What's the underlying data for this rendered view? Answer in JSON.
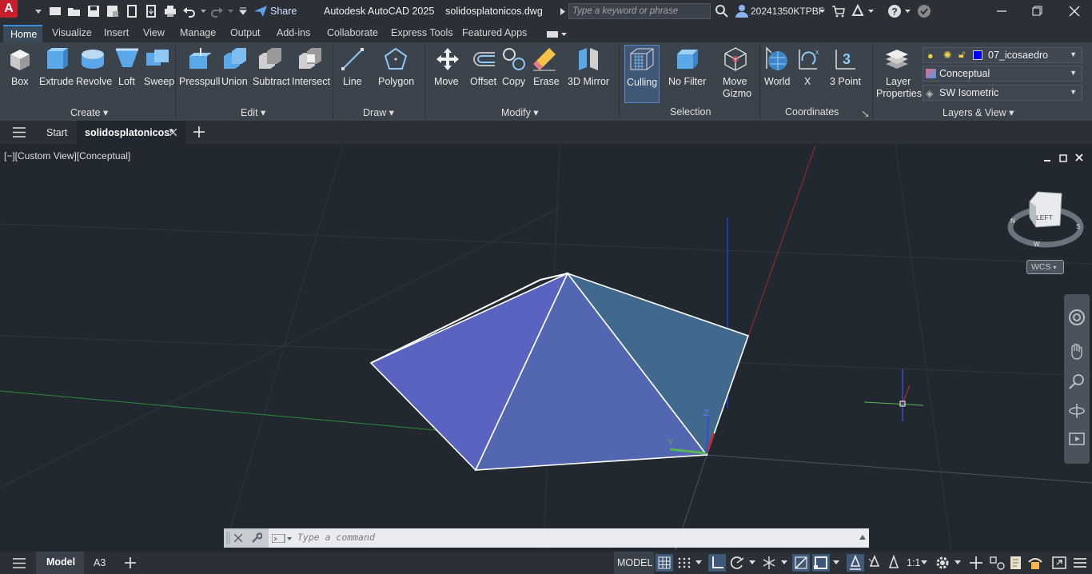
{
  "titlebar": {
    "logo_letter": "A",
    "share_label": "Share",
    "app_title": "Autodesk AutoCAD 2025    solidosplatonicos.dwg",
    "search_placeholder": "Type a keyword or phrase",
    "user_name": "20241350KTPBF"
  },
  "ribbon_tabs": [
    "Home",
    "Visualize",
    "Insert",
    "View",
    "Manage",
    "Output",
    "Add-ins",
    "Collaborate",
    "Express Tools",
    "Featured Apps"
  ],
  "ribbon": {
    "create": {
      "label": "Create",
      "tools": [
        "Box",
        "Extrude",
        "Revolve",
        "Loft",
        "Sweep"
      ]
    },
    "edit": {
      "label": "Edit",
      "tools": [
        "Presspull",
        "Union",
        "Subtract",
        "Intersect"
      ]
    },
    "draw": {
      "label": "Draw",
      "tools": [
        "Line",
        "Polygon"
      ]
    },
    "modify": {
      "label": "Modify",
      "tools": [
        "Move",
        "Offset",
        "Copy",
        "Erase",
        "3D Mirror"
      ]
    },
    "selection": {
      "label": "Selection",
      "tools": [
        "Culling",
        "No Filter",
        "Move",
        "Gizmo"
      ]
    },
    "coordinates": {
      "label": "Coordinates",
      "tools": [
        "World",
        "X",
        "3 Point"
      ]
    },
    "layers": {
      "label": "Layers & View",
      "layer_props_1": "Layer",
      "layer_props_2": "Properties",
      "current_layer": "07_icosaedro",
      "visual_style": "Conceptual",
      "view": "SW Isometric",
      "layer_color": "#0000ff"
    }
  },
  "file_tabs": {
    "start": "Start",
    "active": "solidosplatonicos*"
  },
  "viewport": {
    "label": "[−][Custom View][Conceptual]",
    "viewcube_face": "LEFT",
    "wcs": "WCS",
    "ucs_z": "Z",
    "ucs_y": "Y",
    "compass_n": "N",
    "compass_w": "W",
    "compass_s": "S"
  },
  "command": {
    "placeholder": "Type  a  command"
  },
  "status": {
    "model_tab": "Model",
    "layout_tab": "A3",
    "model_label": "MODEL",
    "scale": "1:1"
  },
  "colors": {
    "accent": "#3b8fd9",
    "background": "#212830",
    "face_left": "#5a63c0",
    "face_center": "#5366b2",
    "face_right": "#41698e"
  }
}
